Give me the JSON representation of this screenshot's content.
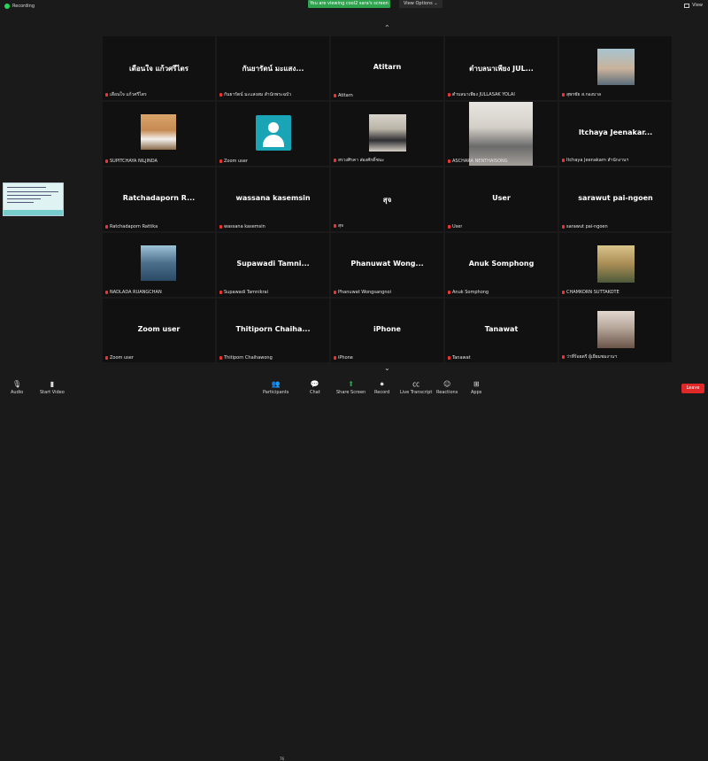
{
  "top_bar": {
    "recording_label": "Recording",
    "viewing_banner": "You are viewing cool2 sara's screen",
    "view_options_label": "View Options",
    "view_button_label": "View"
  },
  "participants": [
    {
      "display_name": "เดือนใจ แก้วศรีไตร",
      "label": "เดือนใจ แก้วศรีไตร",
      "kind": "name"
    },
    {
      "display_name": "กันยารัตน์ มะแสง...",
      "label": "กันยารัตน์ มะแสงสม สำนักพระฉบัว",
      "kind": "name"
    },
    {
      "display_name": "Atitarn",
      "label": "Atitarn",
      "kind": "name"
    },
    {
      "display_name": "ตำบลนาเพียง JUL...",
      "label": "ตำบลนาเพียง JULLASAK YOLAI",
      "kind": "name"
    },
    {
      "display_name": "",
      "label": "สุพรชัย ส.กองบาล",
      "kind": "video"
    },
    {
      "display_name": "",
      "label": "SUPITCHAYA NILJINDA",
      "kind": "video"
    },
    {
      "display_name": "",
      "label": "Zoom user",
      "kind": "avatar"
    },
    {
      "display_name": "",
      "label": "สรวงศิรคา ส่องศักดิ์ชนะ",
      "kind": "video"
    },
    {
      "display_name": "",
      "label": "ASCHARA NENTHAISONG",
      "kind": "video"
    },
    {
      "display_name": "Itchaya Jeenakar...",
      "label": "Itchaya Jeenakarn สำนักงานฯ",
      "kind": "name"
    },
    {
      "display_name": "Ratchadaporn R...",
      "label": "Ratchadaporn Rattika",
      "kind": "name"
    },
    {
      "display_name": "wassana kasemsin",
      "label": "wassana kasemsin",
      "kind": "name"
    },
    {
      "display_name": "สุจ",
      "label": "สุจ",
      "kind": "name"
    },
    {
      "display_name": "User",
      "label": "User",
      "kind": "name"
    },
    {
      "display_name": "sarawut pai-ngoen",
      "label": "sarawut pai-ngoen",
      "kind": "name"
    },
    {
      "display_name": "",
      "label": "NADLADA RUANGCHAN",
      "kind": "video"
    },
    {
      "display_name": "Supawadi Tamni...",
      "label": "Supawadi Tamnikrai",
      "kind": "name"
    },
    {
      "display_name": "Phanuwat Wong...",
      "label": "Phanuwat Wongsangnoi",
      "kind": "name"
    },
    {
      "display_name": "Anuk Somphong",
      "label": "Anuk Somphong",
      "kind": "name"
    },
    {
      "display_name": "",
      "label": "CHAMKORN SUTTAKOTE",
      "kind": "video"
    },
    {
      "display_name": "Zoom user",
      "label": "Zoom user",
      "kind": "name"
    },
    {
      "display_name": "Thitiporn Chaiha...",
      "label": "Thitiporn Chaihawong",
      "kind": "name"
    },
    {
      "display_name": "iPhone",
      "label": "iPhone",
      "kind": "name"
    },
    {
      "display_name": "Tanawat",
      "label": "Tanawat",
      "kind": "name"
    },
    {
      "display_name": "",
      "label": "ว่าที่ร้อยตรี ผู้เยี่ยมชมงานฯ",
      "kind": "video"
    }
  ],
  "toolbar": {
    "audio_label": "Audio",
    "start_video_label": "Start Video",
    "participants_label": "Participants",
    "participants_count": "76",
    "chat_label": "Chat",
    "share_screen_label": "Share Screen",
    "record_label": "Record",
    "live_transcript_label": "Live Transcript",
    "reactions_label": "Reactions",
    "apps_label": "Apps",
    "leave_label": "Leave"
  }
}
